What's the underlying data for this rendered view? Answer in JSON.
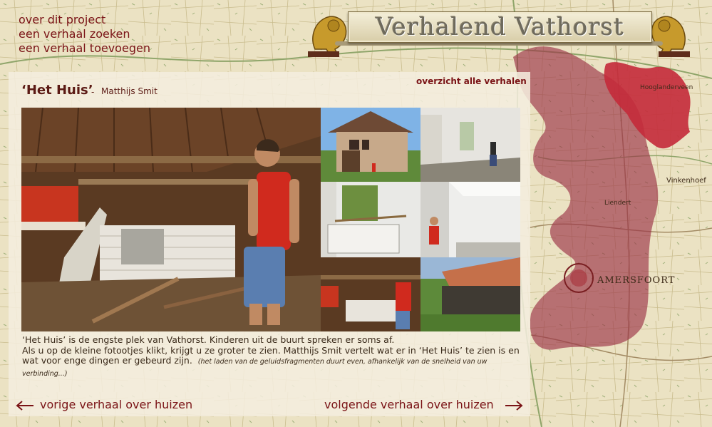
{
  "nav": {
    "about": "over dit project",
    "search": "een verhaal zoeken",
    "add": "een verhaal toevoegen"
  },
  "site_title": "Verhalend Vathorst",
  "story": {
    "title": "‘Het Huis’",
    "separator": "-",
    "author": "Matthijs Smit",
    "overview_link": "overzicht alle verhalen",
    "description_line1": "‘Het Huis’ is de engste plek van Vathorst. Kinderen uit de buurt spreken er soms af.",
    "description_line2": "Als u op de kleine fotootjes klikt, krijgt u ze groter te zien. Matthijs Smit vertelt wat er in ‘Het Huis’ te zien is en wat voor enge dingen er gebeurd zijn.",
    "description_note": "(het laden van de geluidsfragmenten duurt even, afhankelijk van de snelheid van uw verbinding...)"
  },
  "bottom_nav": {
    "previous": "vorige verhaal over huizen",
    "next": "volgende verhaal over huizen"
  },
  "map_labels": {
    "label1": "Hooglanderveen",
    "label2": "Vinkenhoef",
    "label3": "Liendert",
    "label4": "AMERSFOORT"
  },
  "colors": {
    "accent": "#7a1316",
    "highlight_area": "#c42a3a",
    "region_area": "#9b3346"
  }
}
